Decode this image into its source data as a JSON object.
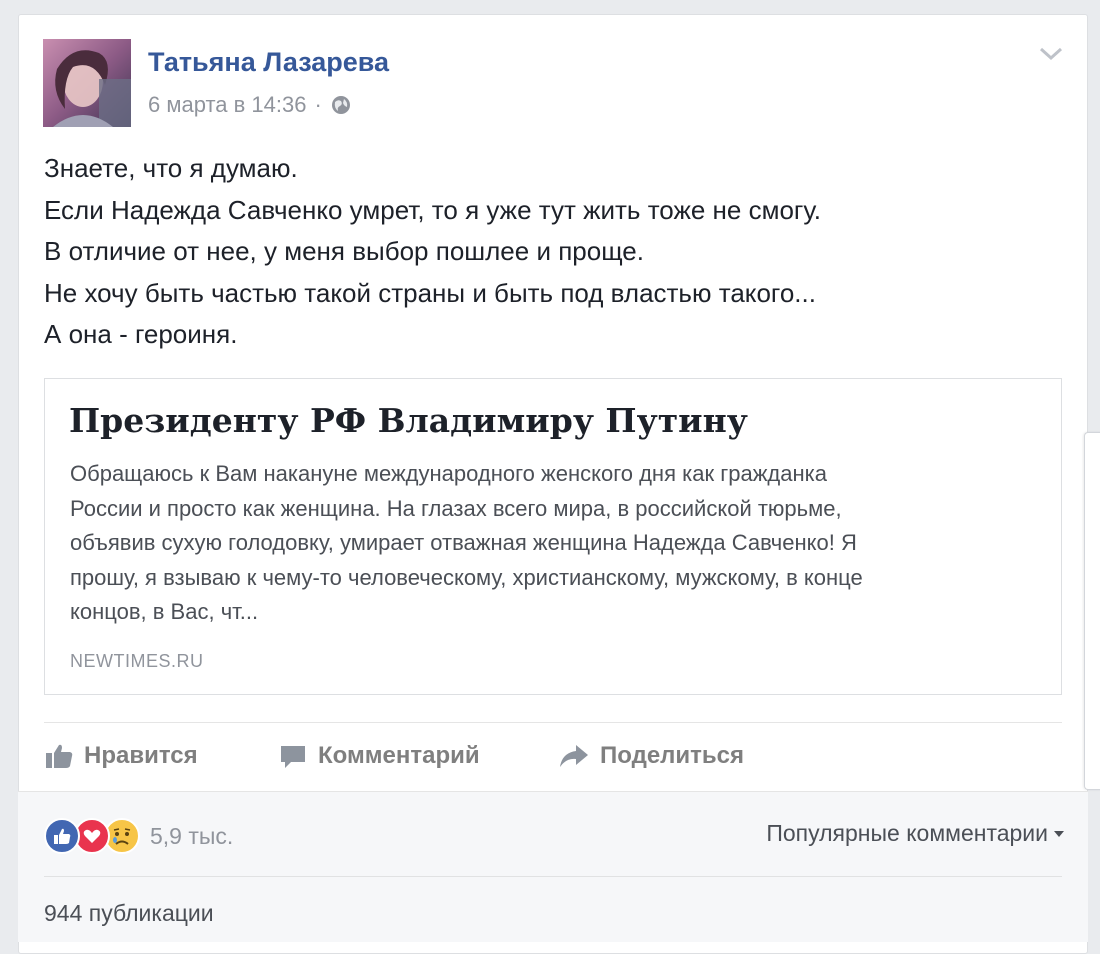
{
  "post": {
    "author": "Татьяна Лазарева",
    "date": "6 марта в 14:36",
    "separator": "·",
    "privacy_icon": "globe-icon",
    "options_icon": "chevron-down-icon",
    "text_lines": [
      "Знаете, что я думаю.",
      "Если Надежда Савченко умрет, то я уже тут жить тоже не смогу.",
      "В отличие от нее, у меня выбор пошлее и проще.",
      "Не хочу быть частью такой страны и быть под властью такого...",
      "А она - героиня."
    ]
  },
  "link": {
    "title": "Президенту РФ Владимиру Путину",
    "description_lines": [
      "Обращаюсь к Вам накануне международного женского дня как гражданка",
      "России и просто как женщина. На глазах всего мира, в российской тюрьме,",
      "объявив сухую голодовку, умирает отважная женщина Надежда Савченко! Я",
      "прошу, я взываю к чему-то человеческому, христианскому, мужскому, в конце",
      "концов, в Вас, чт..."
    ],
    "domain": "NEWTIMES.RU"
  },
  "actions": {
    "like": "Нравится",
    "comment": "Комментарий",
    "share": "Поделиться"
  },
  "footer": {
    "reactions": [
      "like-reaction-icon",
      "love-reaction-icon",
      "sad-reaction-icon"
    ],
    "reaction_count": "5,9 тыс.",
    "sort_label": "Популярные комментарии",
    "shares": "944 публикации"
  },
  "colors": {
    "author": "#365899",
    "like_blue": "#4267b2",
    "love_red": "#e9344e",
    "sad_yellow": "#f7c547"
  }
}
